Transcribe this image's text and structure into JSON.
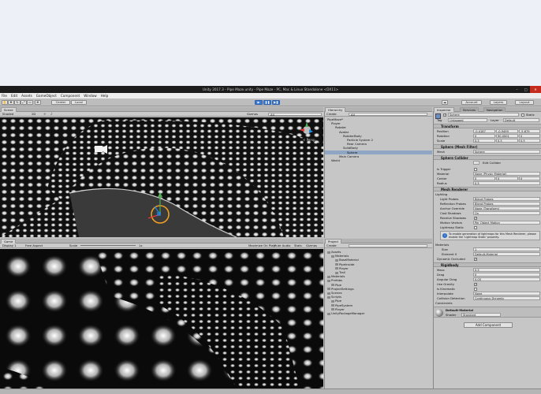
{
  "window": {
    "title": "Unity 2017.3 - Pipe Maze.unity - Pipe Maze - PC, Mac & Linux Standalone <DX11>"
  },
  "menu": [
    "File",
    "Edit",
    "Assets",
    "GameObject",
    "Component",
    "Window",
    "Help"
  ],
  "toolbar": {
    "pivot": "Center",
    "space": "Local",
    "account": "Account",
    "layers": "Layers",
    "layout": "Layout"
  },
  "scene": {
    "tab": "Scene",
    "shading": "Shaded",
    "mode": "2D",
    "gizmos": "Gizmos",
    "search": "All"
  },
  "game": {
    "tab": "Game",
    "display": "Display 1",
    "aspect": "Free Aspect",
    "scale": "Scale",
    "scale_value": "1x",
    "maximize": "Maximize On Play",
    "mute": "Mute Audio",
    "stats": "Stats",
    "gizmos": "Gizmos"
  },
  "hierarchy": {
    "tab": "Hierarchy",
    "create": "Create",
    "search": "All",
    "items": [
      {
        "label": "PipeMaze*",
        "indent": 0
      },
      {
        "label": "Player",
        "indent": 1
      },
      {
        "label": "Rotater",
        "indent": 2
      },
      {
        "label": "Avatar",
        "indent": 3
      },
      {
        "label": "RotaterBody",
        "indent": 4
      },
      {
        "label": "Particle System 2",
        "indent": 5
      },
      {
        "label": "Rear Camera",
        "indent": 5
      },
      {
        "label": "SolidBody",
        "indent": 4
      },
      {
        "label": "Sphere",
        "indent": 5,
        "selected": true
      },
      {
        "label": "Main Camera",
        "indent": 3
      },
      {
        "label": "World",
        "indent": 1
      }
    ]
  },
  "project": {
    "tab": "Project",
    "create": "Create",
    "items": [
      {
        "label": "Assets",
        "indent": 0
      },
      {
        "label": "Materials",
        "indent": 1
      },
      {
        "label": "BaseMaterial",
        "indent": 2
      },
      {
        "label": "PipeInside",
        "indent": 2
      },
      {
        "label": "Player",
        "indent": 2
      },
      {
        "label": "Trail",
        "indent": 2
      },
      {
        "label": "Materials",
        "indent": 0
      },
      {
        "label": "Prefabs",
        "indent": 0
      },
      {
        "label": "Pipe",
        "indent": 1
      },
      {
        "label": "ProjectSettings",
        "indent": 0
      },
      {
        "label": "Scenes",
        "indent": 0
      },
      {
        "label": "Scripts",
        "indent": 0
      },
      {
        "label": "Pipe",
        "indent": 1
      },
      {
        "label": "PipeSystem",
        "indent": 1
      },
      {
        "label": "Player",
        "indent": 1
      },
      {
        "label": "UnityPackageManager",
        "indent": 0
      }
    ]
  },
  "inspector": {
    "tabs": [
      "Inspector",
      "Services",
      "Navigation"
    ],
    "object_name": "Sphere",
    "static": "Static",
    "tag_label": "Tag",
    "tag": "Untagged",
    "layer_label": "Layer",
    "layer": "Default",
    "transform": {
      "title": "Transform",
      "position": {
        "label": "Position",
        "x": "-0.4187",
        "y": "-0.9499",
        "z": "-5.679"
      },
      "rotation": {
        "label": "Rotation",
        "x": "0",
        "y": "90.0001",
        "z": "0"
      },
      "scale": {
        "label": "Scale",
        "x": "0.5",
        "y": "0.5",
        "z": "0.5"
      }
    },
    "mesh_filter": {
      "title": "Sphere (Mesh Filter)",
      "mesh_label": "Mesh",
      "mesh": "Sphere"
    },
    "sphere_collider": {
      "title": "Sphere Collider",
      "edit": "Edit Collider",
      "is_trigger": "Is Trigger",
      "material_label": "Material",
      "material": "None (Physic Material)",
      "center_label": "Center",
      "center": {
        "x": "0",
        "y": "0",
        "z": "0"
      },
      "radius_label": "Radius",
      "radius": "0.5"
    },
    "mesh_renderer": {
      "title": "Mesh Renderer",
      "lighting": "Lighting",
      "light_probes_label": "Light Probes",
      "light_probes": "Blend Probes",
      "reflection_probes_label": "Reflection Probes",
      "reflection_probes": "Blend Probes",
      "anchor_override_label": "Anchor Override",
      "anchor_override": "None (Transform)",
      "cast_shadows_label": "Cast Shadows",
      "cast_shadows": "On",
      "receive_shadows_label": "Receive Shadows",
      "motion_vectors_label": "Motion Vectors",
      "motion_vectors": "Per Object Motion",
      "lightmap_static_label": "Lightmap Static",
      "info": "To enable generation of lightmaps for this Mesh Renderer, please enable the 'Lightmap Static' property.",
      "materials_label": "Materials",
      "size_label": "Size",
      "size": "1",
      "element0_label": "Element 0",
      "element0": "Default-Material",
      "dynamic_occluded_label": "Dynamic Occluded"
    },
    "rigidbody": {
      "title": "Rigidbody",
      "mass_label": "Mass",
      "mass": "0.5",
      "drag_label": "Drag",
      "drag": "0",
      "angular_drag_label": "Angular Drag",
      "angular_drag": "0.05",
      "use_gravity_label": "Use Gravity",
      "is_kinematic_label": "Is Kinematic",
      "interpolate_label": "Interpolate",
      "interpolate": "None",
      "collision_label": "Collision Detection",
      "collision": "Continuous Dynamic",
      "constraints_label": "Constraints"
    },
    "material": {
      "name": "Default-Material",
      "shader_label": "Shader",
      "shader": "Standard"
    },
    "add_component": "Add Component"
  }
}
